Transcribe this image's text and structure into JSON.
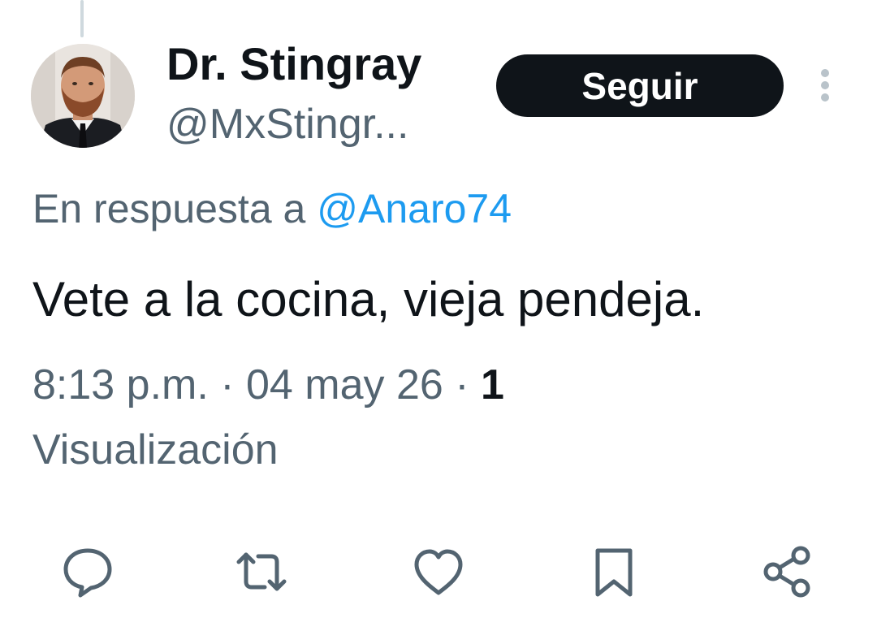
{
  "tweet": {
    "author": {
      "display_name": "Dr. Stingray",
      "handle": "@MxStingr..."
    },
    "follow_label": "Seguir",
    "reply_context": {
      "prefix": "En respuesta a ",
      "mention": "@Anaro74"
    },
    "text": "Vete a la cocina, vieja pendeja.",
    "meta": {
      "time": "8:13 p.m.",
      "separator": " · ",
      "date": "04 may 26",
      "views_count": "1",
      "views_label": "Visualización"
    }
  },
  "actions": [
    {
      "name": "reply",
      "icon": "comment-icon"
    },
    {
      "name": "repost",
      "icon": "repost-icon"
    },
    {
      "name": "like",
      "icon": "heart-icon"
    },
    {
      "name": "bookmark",
      "icon": "bookmark-icon"
    },
    {
      "name": "share",
      "icon": "share-icon"
    }
  ],
  "colors": {
    "text_primary": "#0f1419",
    "text_secondary": "#536471",
    "link": "#1d9bf0",
    "follow_bg": "#0f1419",
    "thread_line": "#cfd9de"
  }
}
